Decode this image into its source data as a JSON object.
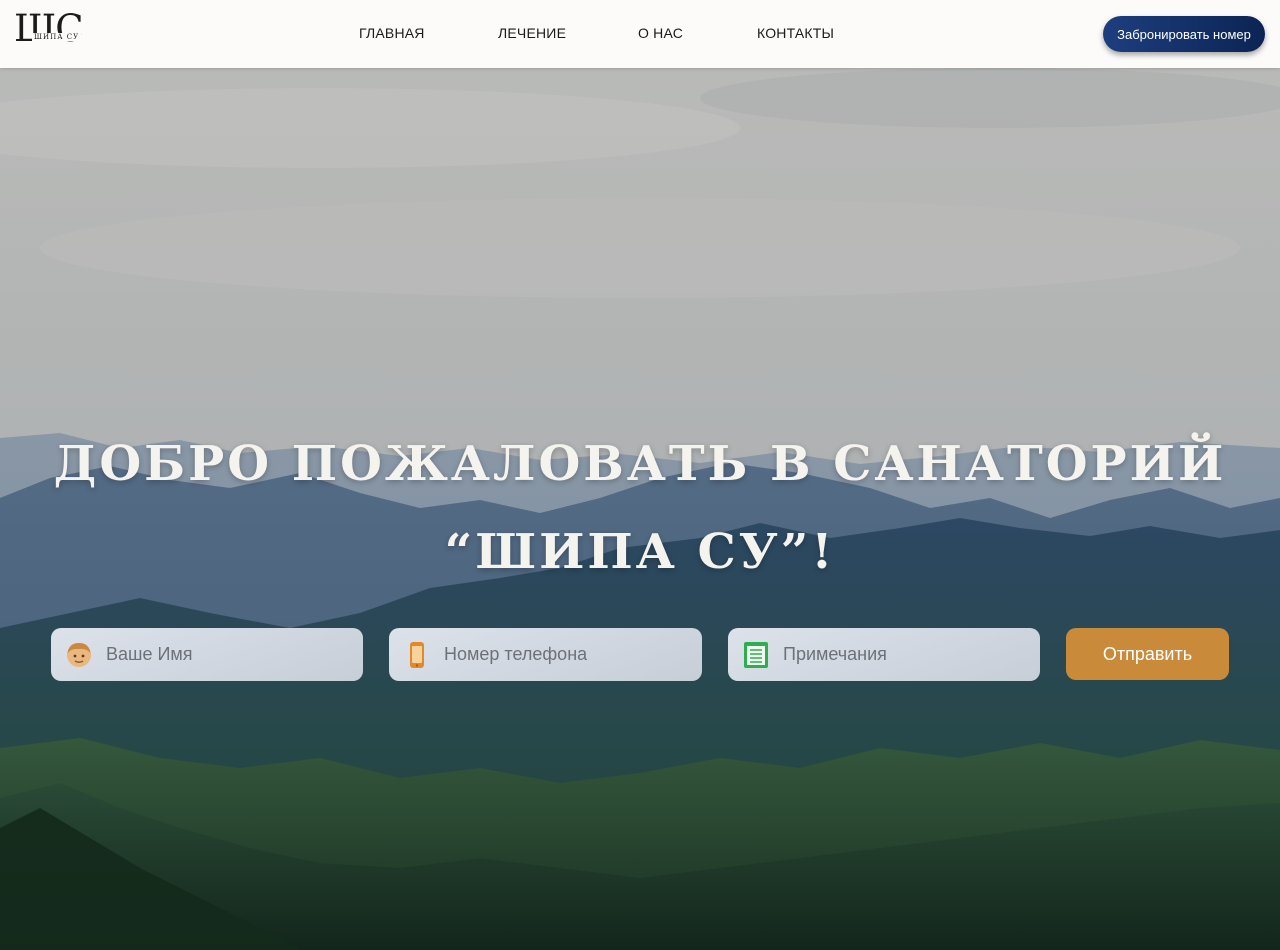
{
  "header": {
    "logo": {
      "mark": "ШС",
      "sub": "ШИПА СУ"
    },
    "nav": [
      {
        "label": "ГЛАВНАЯ"
      },
      {
        "label": "ЛЕЧЕНИЕ"
      },
      {
        "label": "О НАС"
      },
      {
        "label": "КОНТАКТЫ"
      }
    ],
    "book_button": "Забронировать номер"
  },
  "hero": {
    "title_line1": "ДОБРО ПОЖАЛОВАТЬ В САНАТОРИЙ",
    "title_line2": "“ШИПА СУ”!"
  },
  "form": {
    "name": {
      "placeholder": "Ваше Имя",
      "icon": "person-icon"
    },
    "phone": {
      "placeholder": "Номер телефона",
      "icon": "phone-icon"
    },
    "notes": {
      "placeholder": "Примечания",
      "icon": "notepad-icon"
    },
    "submit": "Отправить"
  },
  "colors": {
    "accent_button": "#c98a3a",
    "book_button": "#0b2454",
    "header_bg": "#fcfbfa"
  }
}
